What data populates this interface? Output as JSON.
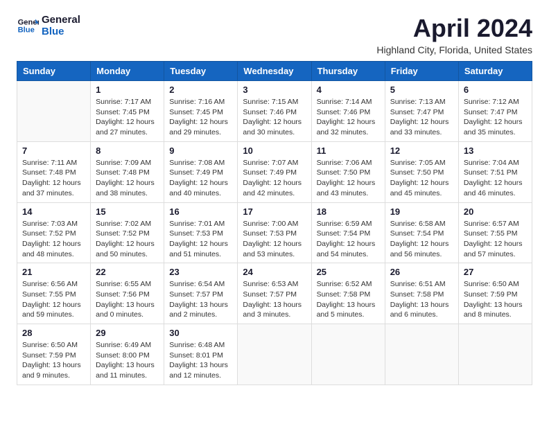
{
  "logo": {
    "line1": "General",
    "line2": "Blue"
  },
  "title": "April 2024",
  "subtitle": "Highland City, Florida, United States",
  "weekdays": [
    "Sunday",
    "Monday",
    "Tuesday",
    "Wednesday",
    "Thursday",
    "Friday",
    "Saturday"
  ],
  "weeks": [
    [
      {
        "day": "",
        "detail": ""
      },
      {
        "day": "1",
        "detail": "Sunrise: 7:17 AM\nSunset: 7:45 PM\nDaylight: 12 hours\nand 27 minutes."
      },
      {
        "day": "2",
        "detail": "Sunrise: 7:16 AM\nSunset: 7:45 PM\nDaylight: 12 hours\nand 29 minutes."
      },
      {
        "day": "3",
        "detail": "Sunrise: 7:15 AM\nSunset: 7:46 PM\nDaylight: 12 hours\nand 30 minutes."
      },
      {
        "day": "4",
        "detail": "Sunrise: 7:14 AM\nSunset: 7:46 PM\nDaylight: 12 hours\nand 32 minutes."
      },
      {
        "day": "5",
        "detail": "Sunrise: 7:13 AM\nSunset: 7:47 PM\nDaylight: 12 hours\nand 33 minutes."
      },
      {
        "day": "6",
        "detail": "Sunrise: 7:12 AM\nSunset: 7:47 PM\nDaylight: 12 hours\nand 35 minutes."
      }
    ],
    [
      {
        "day": "7",
        "detail": "Sunrise: 7:11 AM\nSunset: 7:48 PM\nDaylight: 12 hours\nand 37 minutes."
      },
      {
        "day": "8",
        "detail": "Sunrise: 7:09 AM\nSunset: 7:48 PM\nDaylight: 12 hours\nand 38 minutes."
      },
      {
        "day": "9",
        "detail": "Sunrise: 7:08 AM\nSunset: 7:49 PM\nDaylight: 12 hours\nand 40 minutes."
      },
      {
        "day": "10",
        "detail": "Sunrise: 7:07 AM\nSunset: 7:49 PM\nDaylight: 12 hours\nand 42 minutes."
      },
      {
        "day": "11",
        "detail": "Sunrise: 7:06 AM\nSunset: 7:50 PM\nDaylight: 12 hours\nand 43 minutes."
      },
      {
        "day": "12",
        "detail": "Sunrise: 7:05 AM\nSunset: 7:50 PM\nDaylight: 12 hours\nand 45 minutes."
      },
      {
        "day": "13",
        "detail": "Sunrise: 7:04 AM\nSunset: 7:51 PM\nDaylight: 12 hours\nand 46 minutes."
      }
    ],
    [
      {
        "day": "14",
        "detail": "Sunrise: 7:03 AM\nSunset: 7:52 PM\nDaylight: 12 hours\nand 48 minutes."
      },
      {
        "day": "15",
        "detail": "Sunrise: 7:02 AM\nSunset: 7:52 PM\nDaylight: 12 hours\nand 50 minutes."
      },
      {
        "day": "16",
        "detail": "Sunrise: 7:01 AM\nSunset: 7:53 PM\nDaylight: 12 hours\nand 51 minutes."
      },
      {
        "day": "17",
        "detail": "Sunrise: 7:00 AM\nSunset: 7:53 PM\nDaylight: 12 hours\nand 53 minutes."
      },
      {
        "day": "18",
        "detail": "Sunrise: 6:59 AM\nSunset: 7:54 PM\nDaylight: 12 hours\nand 54 minutes."
      },
      {
        "day": "19",
        "detail": "Sunrise: 6:58 AM\nSunset: 7:54 PM\nDaylight: 12 hours\nand 56 minutes."
      },
      {
        "day": "20",
        "detail": "Sunrise: 6:57 AM\nSunset: 7:55 PM\nDaylight: 12 hours\nand 57 minutes."
      }
    ],
    [
      {
        "day": "21",
        "detail": "Sunrise: 6:56 AM\nSunset: 7:55 PM\nDaylight: 12 hours\nand 59 minutes."
      },
      {
        "day": "22",
        "detail": "Sunrise: 6:55 AM\nSunset: 7:56 PM\nDaylight: 13 hours\nand 0 minutes."
      },
      {
        "day": "23",
        "detail": "Sunrise: 6:54 AM\nSunset: 7:57 PM\nDaylight: 13 hours\nand 2 minutes."
      },
      {
        "day": "24",
        "detail": "Sunrise: 6:53 AM\nSunset: 7:57 PM\nDaylight: 13 hours\nand 3 minutes."
      },
      {
        "day": "25",
        "detail": "Sunrise: 6:52 AM\nSunset: 7:58 PM\nDaylight: 13 hours\nand 5 minutes."
      },
      {
        "day": "26",
        "detail": "Sunrise: 6:51 AM\nSunset: 7:58 PM\nDaylight: 13 hours\nand 6 minutes."
      },
      {
        "day": "27",
        "detail": "Sunrise: 6:50 AM\nSunset: 7:59 PM\nDaylight: 13 hours\nand 8 minutes."
      }
    ],
    [
      {
        "day": "28",
        "detail": "Sunrise: 6:50 AM\nSunset: 7:59 PM\nDaylight: 13 hours\nand 9 minutes."
      },
      {
        "day": "29",
        "detail": "Sunrise: 6:49 AM\nSunset: 8:00 PM\nDaylight: 13 hours\nand 11 minutes."
      },
      {
        "day": "30",
        "detail": "Sunrise: 6:48 AM\nSunset: 8:01 PM\nDaylight: 13 hours\nand 12 minutes."
      },
      {
        "day": "",
        "detail": ""
      },
      {
        "day": "",
        "detail": ""
      },
      {
        "day": "",
        "detail": ""
      },
      {
        "day": "",
        "detail": ""
      }
    ]
  ]
}
